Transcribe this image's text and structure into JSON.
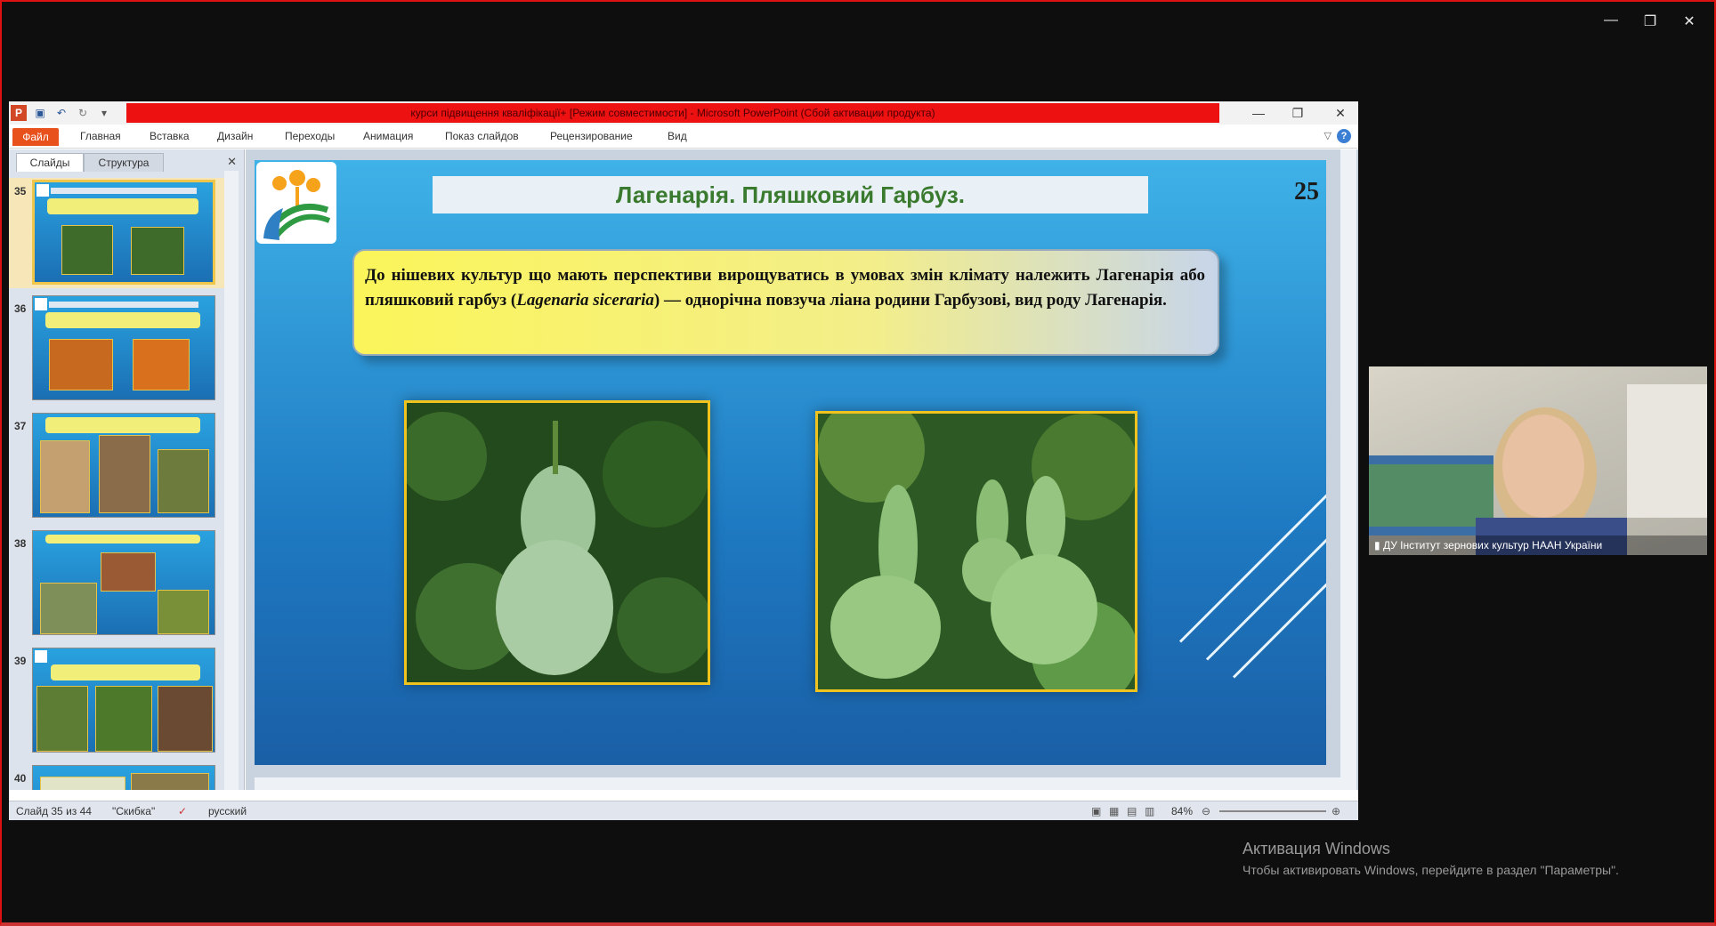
{
  "window": {
    "title": "курси підвищення кваліфікації+ [Режим совместимости]  -  Microsoft PowerPoint (Сбой активации продукта)",
    "minimize": "—",
    "restore": "❐",
    "close": "✕"
  },
  "outer_window": {
    "minimize": "—",
    "restore": "❐",
    "close": "✕"
  },
  "ribbon": {
    "file": "Файл",
    "tabs": [
      "Главная",
      "Вставка",
      "Дизайн",
      "Переходы",
      "Анимация",
      "Показ слайдов",
      "Рецензирование",
      "Вид"
    ],
    "help": "?"
  },
  "panel": {
    "tabs": [
      "Слайды",
      "Структура"
    ],
    "close": "✕",
    "thumbnails": [
      {
        "number": "35"
      },
      {
        "number": "36"
      },
      {
        "number": "37"
      },
      {
        "number": "38"
      },
      {
        "number": "39"
      },
      {
        "number": "40"
      }
    ]
  },
  "slide": {
    "title": "Лагенарія. Пляшковий Гарбуз.",
    "number": "25",
    "text_a": "До нішевих культур що мають перспективи вирощуватись в умовах змін клімату належить Лагенарія або пляшковий гарбуз (",
    "text_latin": "Lagenaria siceraria",
    "text_b": ") — однорічна повзуча ліана родини Гарбузові, вид роду Лагенарія."
  },
  "status": {
    "slide_info": "Слайд 35 из 44",
    "theme": "\"Скибка\"",
    "language": "русский",
    "zoom": "84%"
  },
  "camera": {
    "label": "ДУ Інститут зернових культур НААН України"
  },
  "activation": {
    "title": "Активация Windows",
    "subtitle": "Чтобы активировать Windows, перейдите в раздел \"Параметры\"."
  },
  "colors": {
    "title_strip": "#ee1111",
    "file_tab": "#e8501c",
    "slide_title": "#3a7a2e",
    "photo_border": "#f1c31f"
  }
}
